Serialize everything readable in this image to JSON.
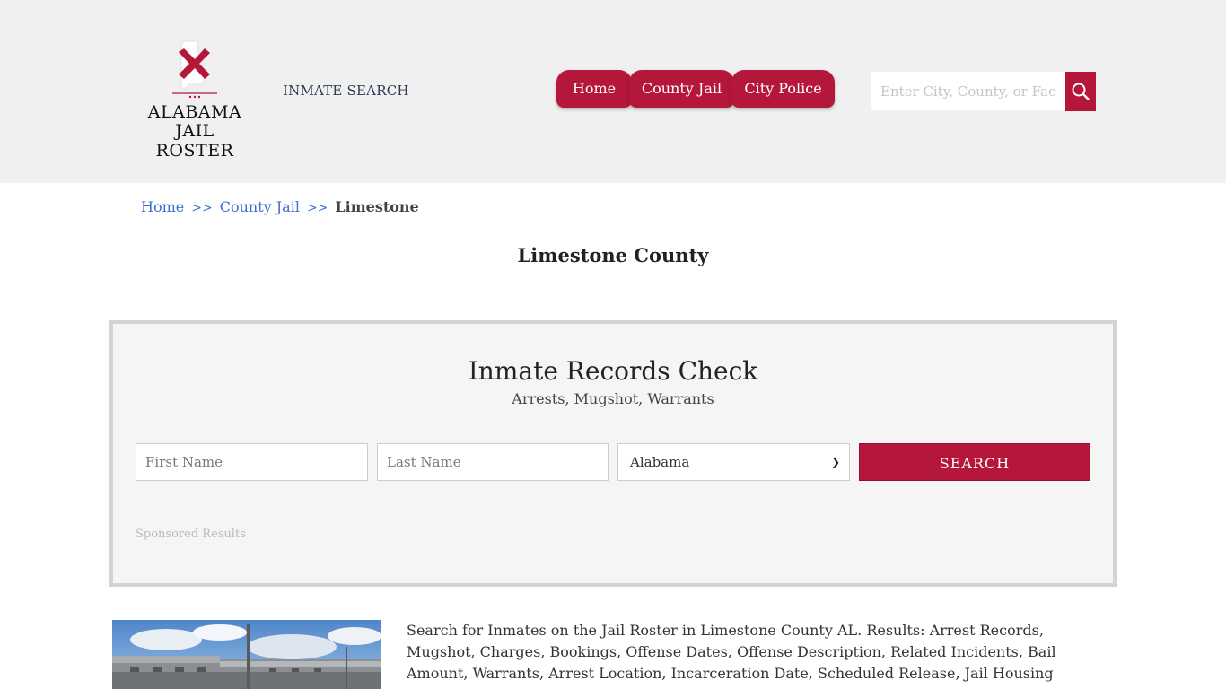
{
  "header": {
    "logo": {
      "line1": "ALABAMA",
      "line2": "JAIL ROSTER"
    },
    "inmate_search_link": "INMATE SEARCH",
    "nav": [
      {
        "label": "Home"
      },
      {
        "label": "County Jail"
      },
      {
        "label": "City Police"
      }
    ],
    "search": {
      "placeholder": "Enter City, County, or Facility"
    }
  },
  "breadcrumb": {
    "items": [
      "Home",
      "County Jail"
    ],
    "separator": ">>",
    "current": "Limestone"
  },
  "page_title": "Limestone County",
  "records_check": {
    "title": "Inmate Records Check",
    "subtitle": "Arrests, Mugshot, Warrants",
    "first_name_placeholder": "First Name",
    "last_name_placeholder": "Last Name",
    "state_selected": "Alabama",
    "search_button": "SEARCH",
    "sponsored": "Sponsored Results"
  },
  "description": "Search for Inmates on the Jail Roster in Limestone County AL. Results: Arrest Records, Mugshot, Charges, Bookings, Offense Dates, Offense Description, Related Incidents, Bail Amount, Warrants, Arrest Location, Incarceration Date, Scheduled Release, Jail Housing Location, Court.",
  "colors": {
    "brand": "#b5173b",
    "header_bg": "#f0f0f0",
    "link": "#3a6fd0"
  },
  "icons": {
    "logo": "alabama-state-flag-icon",
    "search": "magnifier-icon",
    "select": "chevron-down-icon"
  }
}
